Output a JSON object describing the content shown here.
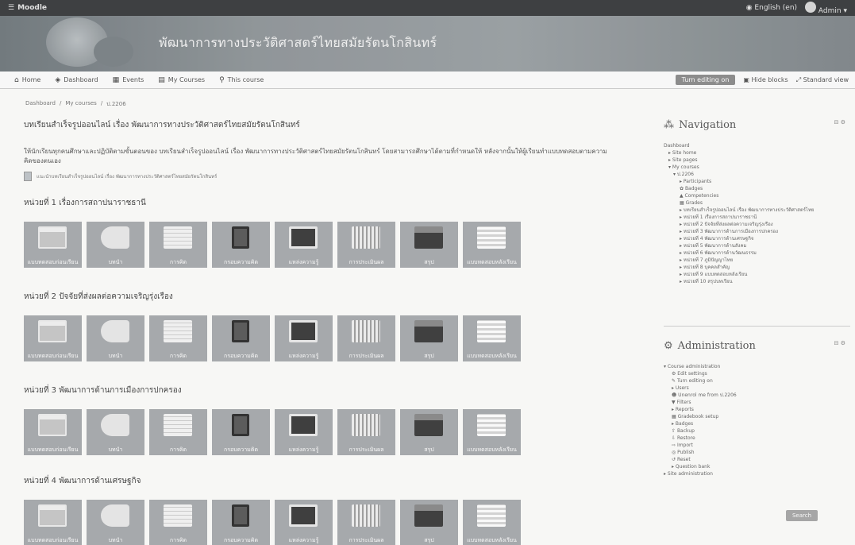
{
  "topbar": {
    "brand": "Moodle",
    "language": "English (en)",
    "user": "Admin"
  },
  "banner": {
    "title": "พัฒนาการทางประวัติศาสตร์ไทยสมัยรัตนโกสินทร์"
  },
  "nav": {
    "items": [
      "Home",
      "Dashboard",
      "Events",
      "My Courses",
      "This course"
    ],
    "edit_button": "Turn editing on",
    "blocks_toggle": "Hide blocks",
    "view_mode": "Standard view"
  },
  "breadcrumb": [
    "Dashboard",
    "My courses",
    "ป.2206"
  ],
  "course": {
    "title": "บทเรียนสำเร็จรูปออนไลน์ เรื่อง พัฒนาการทางประวัติศาสตร์ไทยสมัยรัตนโกสินทร์",
    "intro": "ให้นักเรียนทุกคนศึกษาและปฏิบัติตามขั้นตอนของ บทเรียนสำเร็จรูปออนไลน์ เรื่อง พัฒนาการทางประวัติศาสตร์ไทยสมัยรัตนโกสินทร์ โดยสามารถศึกษาได้ตามที่กำหนดให้ หลังจากนั้นให้ผู้เรียนทำแบบทดสอบตามความคิดของตนเอง",
    "file_link": "แนะนำบทเรียนสำเร็จรูปออนไลน์ เรื่อง พัฒนาการทางประวัติศาสตร์ไทยสมัยรัตนโกสินทร์"
  },
  "sections": [
    {
      "title": "หน่วยที่ 1 เรื่องการสถาปนาราชธานี",
      "tiles": [
        "แบบทดสอบก่อนเรียน",
        "บทนำ",
        "การคิด",
        "กรอบความคิด",
        "แหล่งความรู้",
        "การประเมินผล",
        "สรุป",
        "แบบทดสอบหลังเรียน"
      ]
    },
    {
      "title": "หน่วยที่ 2 ปัจจัยที่ส่งผลต่อความเจริญรุ่งเรือง",
      "tiles": [
        "แบบทดสอบก่อนเรียน",
        "บทนำ",
        "การคิด",
        "กรอบความคิด",
        "แหล่งความรู้",
        "การประเมินผล",
        "สรุป",
        "แบบทดสอบหลังเรียน"
      ]
    },
    {
      "title": "หน่วยที่ 3 พัฒนาการด้านการเมืองการปกครอง",
      "tiles": [
        "แบบทดสอบก่อนเรียน",
        "บทนำ",
        "การคิด",
        "กรอบความคิด",
        "แหล่งความรู้",
        "การประเมินผล",
        "สรุป",
        "แบบทดสอบหลังเรียน"
      ]
    },
    {
      "title": "หน่วยที่ 4 พัฒนาการด้านเศรษฐกิจ",
      "tiles": [
        "แบบทดสอบก่อนเรียน",
        "บทนำ",
        "การคิด",
        "กรอบความคิด",
        "แหล่งความรู้",
        "การประเมินผล",
        "สรุป",
        "แบบทดสอบหลังเรียน"
      ]
    }
  ],
  "navigation_block": {
    "title": "Navigation",
    "items": [
      "Dashboard",
      "Site home",
      "Site pages",
      "My courses",
      "ป.2206",
      "Participants",
      "Badges",
      "Competencies",
      "Grades",
      "บทเรียนสำเร็จรูปออนไลน์ เรื่อง พัฒนาการทางประวัติศาสตร์ไทย",
      "หน่วยที่ 1 เรื่องการสถาปนาราชธานี",
      "หน่วยที่ 2 ปัจจัยที่ส่งผลต่อความเจริญรุ่งเรือง",
      "หน่วยที่ 3 พัฒนาการด้านการเมืองการปกครอง",
      "หน่วยที่ 4 พัฒนาการด้านเศรษฐกิจ",
      "หน่วยที่ 5 พัฒนาการด้านสังคม",
      "หน่วยที่ 6 พัฒนาการด้านวัฒนธรรม",
      "หน่วยที่ 7 ภูมิปัญญาไทย",
      "หน่วยที่ 8 บุคคลสำคัญ",
      "หน่วยที่ 9 แบบทดสอบหลังเรียน",
      "หน่วยที่ 10 สรุปบทเรียน"
    ]
  },
  "admin_block": {
    "title": "Administration",
    "items": [
      "Course administration",
      "Edit settings",
      "Turn editing on",
      "Users",
      "Unenrol me from ป.2206",
      "Filters",
      "Reports",
      "Gradebook setup",
      "Badges",
      "Backup",
      "Restore",
      "Import",
      "Publish",
      "Reset",
      "Question bank",
      "Site administration"
    ],
    "search_button": "Search"
  }
}
